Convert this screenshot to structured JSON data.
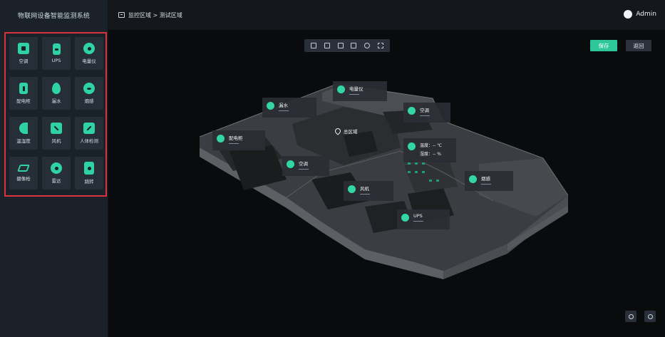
{
  "app": {
    "title": "物联网设备智能监测系统"
  },
  "breadcrumb": {
    "text": "监控区域 > 测试区域"
  },
  "user": {
    "name": "Admin"
  },
  "devices": [
    {
      "label": "空调",
      "icon": "air-conditioner-icon"
    },
    {
      "label": "UPS",
      "icon": "ups-icon"
    },
    {
      "label": "电量仪",
      "icon": "power-meter-icon"
    },
    {
      "label": "配电柜",
      "icon": "distribution-cabinet-icon"
    },
    {
      "label": "漏水",
      "icon": "water-leak-icon"
    },
    {
      "label": "烟感",
      "icon": "smoke-sensor-icon"
    },
    {
      "label": "温湿度",
      "icon": "temp-humidity-icon"
    },
    {
      "label": "风机",
      "icon": "fan-icon"
    },
    {
      "label": "人体检测",
      "icon": "body-sensor-icon"
    },
    {
      "label": "摄像枪",
      "icon": "camera-icon"
    },
    {
      "label": "雷达",
      "icon": "radar-icon"
    },
    {
      "label": "跳转",
      "icon": "jump-pin-icon"
    }
  ],
  "actions": {
    "save": "保存",
    "back": "返回"
  },
  "zone": {
    "label": "总区域"
  },
  "tags": [
    {
      "name": "电量仪"
    },
    {
      "name": "漏水"
    },
    {
      "name": "空调"
    },
    {
      "name": "配电柜"
    },
    {
      "name": "空调"
    },
    {
      "name": "风机"
    },
    {
      "name": "UPS"
    },
    {
      "name": "烟感"
    }
  ],
  "temp_tag": {
    "temp": "温度：-- ℃",
    "humidity": "湿度：-- %"
  },
  "colors": {
    "accent": "#2ec79b",
    "highlight_border": "#d6333a"
  }
}
